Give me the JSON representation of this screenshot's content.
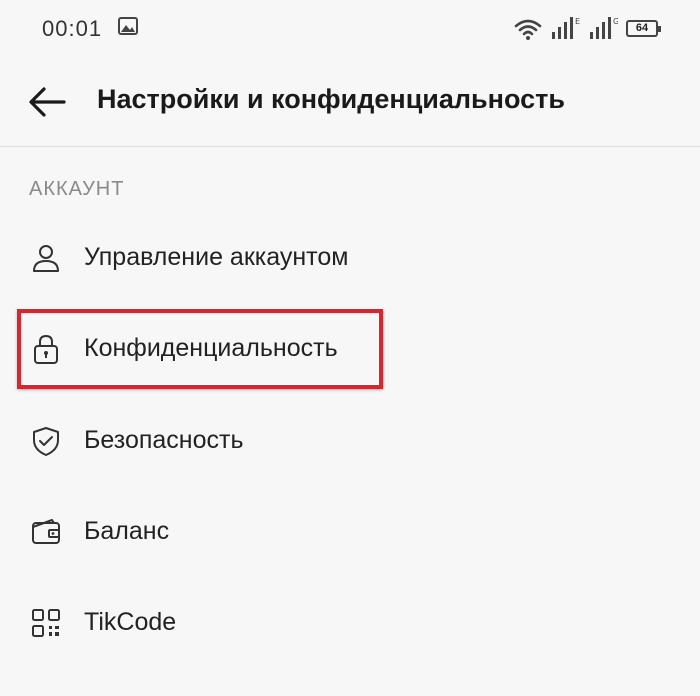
{
  "status_bar": {
    "time": "00:01",
    "battery": "64"
  },
  "header": {
    "title": "Настройки и конфиденциальность"
  },
  "section": {
    "title": "АККАУНТ",
    "items": [
      {
        "label": "Управление аккаунтом",
        "icon": "person-icon"
      },
      {
        "label": "Конфиденциальность",
        "icon": "lock-icon"
      },
      {
        "label": "Безопасность",
        "icon": "shield-icon"
      },
      {
        "label": "Баланс",
        "icon": "wallet-icon"
      },
      {
        "label": "TikCode",
        "icon": "qr-code-icon"
      }
    ]
  },
  "colors": {
    "highlight": "#d7262d",
    "background": "#f7f7f7",
    "section_header": "#8a8a8a"
  }
}
